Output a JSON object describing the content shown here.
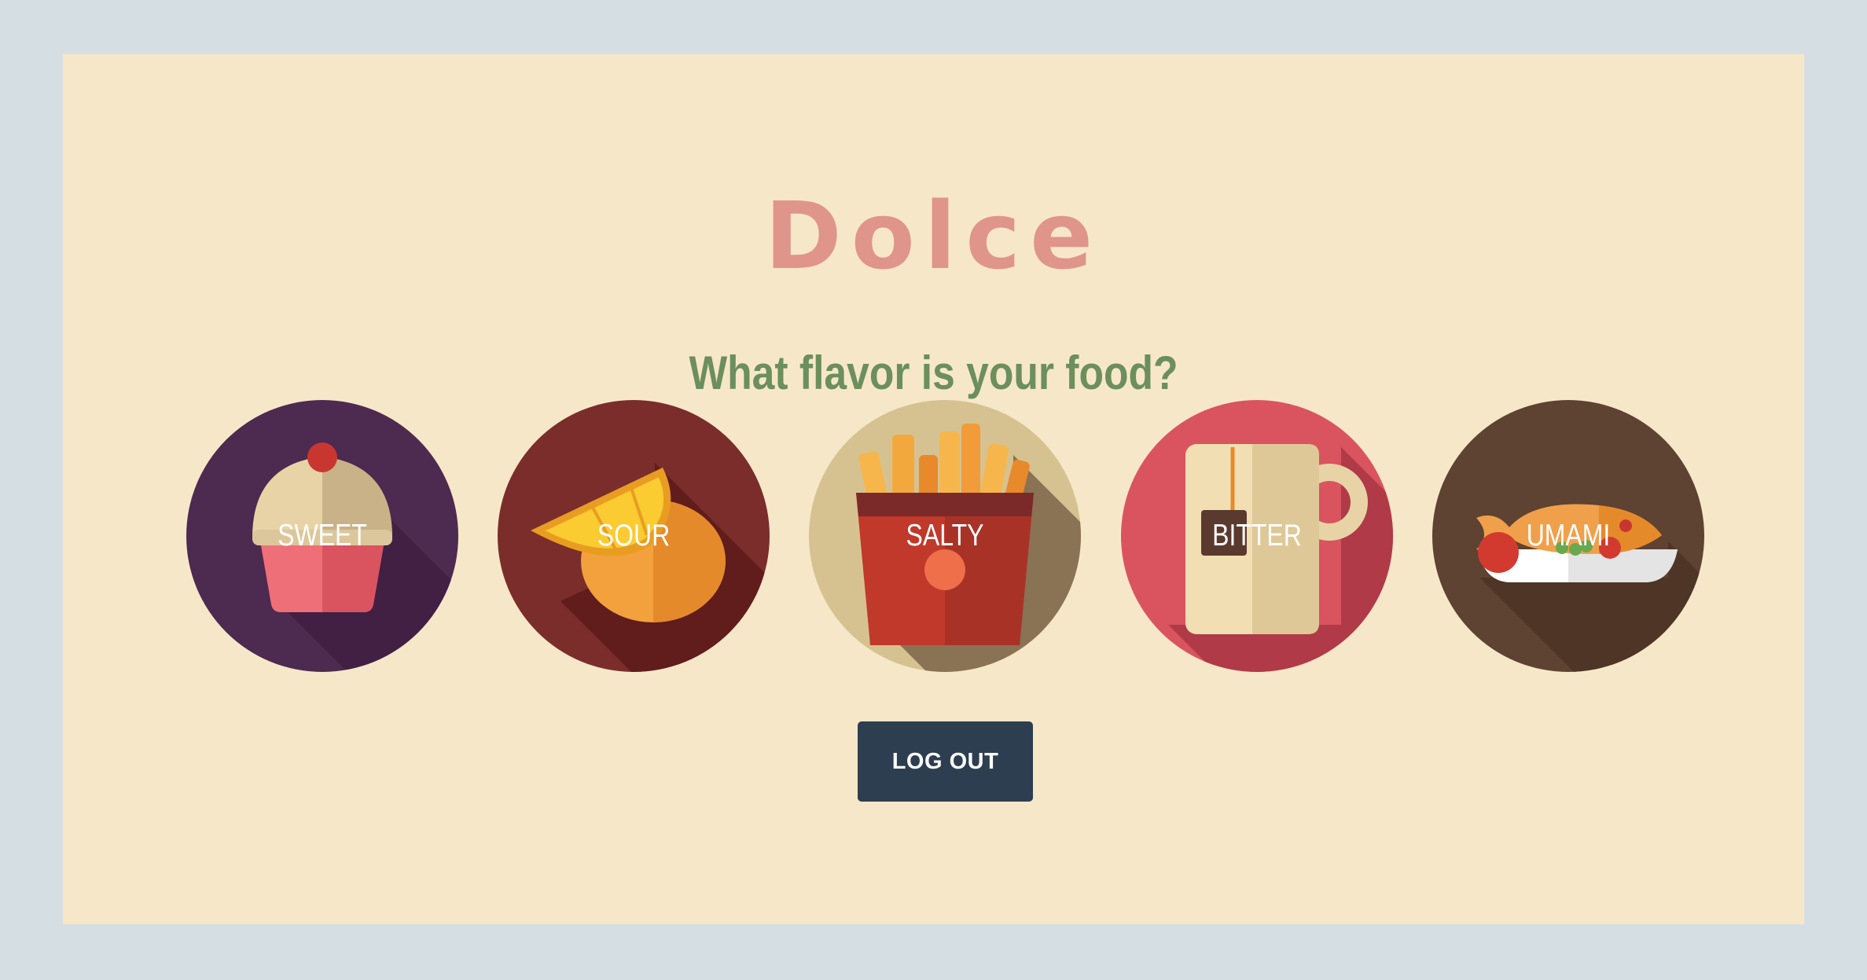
{
  "app": {
    "title": "Dolce",
    "subtitle": "What flavor is your food?"
  },
  "flavors": [
    {
      "label": "SWEET",
      "icon": "cupcake-icon",
      "color": "#4d2a4f"
    },
    {
      "label": "SOUR",
      "icon": "lemon-icon",
      "color": "#7a2d2b"
    },
    {
      "label": "SALTY",
      "icon": "fries-icon",
      "color": "#d6c290"
    },
    {
      "label": "BITTER",
      "icon": "tea-mug-icon",
      "color": "#d9545e"
    },
    {
      "label": "UMAMI",
      "icon": "fish-dish-icon",
      "color": "#5e4232"
    }
  ],
  "actions": {
    "logout_label": "LOG OUT"
  },
  "colors": {
    "page_background": "#d5dee2",
    "card_background": "#f7e7c9",
    "title": "#df958a",
    "subtitle": "#6b8f5d",
    "button": "#2d3e50"
  }
}
